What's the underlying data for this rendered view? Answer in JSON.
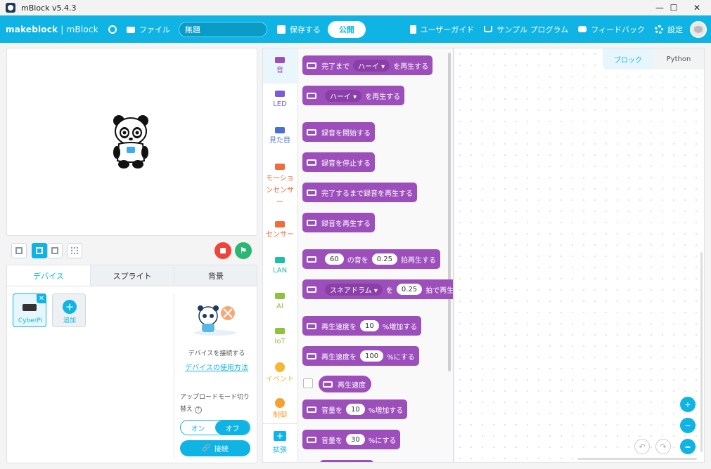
{
  "window": {
    "title": "mBlock v5.4.3",
    "controls": {
      "minimize": "—",
      "maximize": "☐",
      "close": "✕"
    }
  },
  "menubar": {
    "brand": "makeblock",
    "brand_sub": " | mBlock",
    "file": "ファイル",
    "project_name": "無題",
    "save": "保存する",
    "publish": "公開",
    "user_guide": "ユーザーガイド",
    "sample_programs": "サンプル プログラム",
    "feedback": "フィードバック",
    "settings": "設定"
  },
  "device_panel": {
    "tabs": [
      "デバイス",
      "スプライト",
      "背景"
    ],
    "device_name": "CyberPi",
    "add_label": "追加",
    "connect_text": "デバイスを接続する",
    "usage_link": "デバイスの使用方法",
    "upload_mode": "アップロードモード切り替え",
    "upload_help": "?",
    "toggle_on": "オン",
    "toggle_off": "オフ",
    "connect_button": "接続"
  },
  "categories": [
    {
      "label": "音",
      "color": "#9c4fbb"
    },
    {
      "label": "LED",
      "color": "#7a5cd6"
    },
    {
      "label": "見た目",
      "color": "#4c6fcf"
    },
    {
      "label": "モーションセンサー",
      "color": "#f26b3a"
    },
    {
      "label": "センサー",
      "color": "#f26b3a"
    },
    {
      "label": "LAN",
      "color": "#1fbfa7"
    },
    {
      "label": "AI",
      "color": "#8fc13f"
    },
    {
      "label": "IoT",
      "color": "#8fc13f"
    },
    {
      "label": "イベント",
      "color": "#f7b731"
    },
    {
      "label": "制御",
      "color": "#f7a030"
    }
  ],
  "extension_label": "拡張",
  "blocks": {
    "b1": {
      "t1": "完了まで",
      "dd": "ハーイ ▾",
      "t2": "を再生する"
    },
    "b2": {
      "dd": "ハーイ ▾",
      "t2": "を再生する"
    },
    "b3": "録音を開始する",
    "b4": "録音を停止する",
    "b5": "完了するまで録音を再生する",
    "b6": "録音を再生する",
    "b7": {
      "v1": "60",
      "t1": "の音を",
      "v2": "0.25",
      "t2": "拍再生する"
    },
    "b8": {
      "dd": "スネアドラム ▾",
      "t1": "を",
      "v1": "0.25",
      "t2": "拍で再生"
    },
    "b9": {
      "t1": "再生速度を",
      "v1": "10",
      "t2": "%増加する"
    },
    "b10": {
      "t1": "再生速度を",
      "v1": "100",
      "t2": "%にする"
    },
    "b11": "再生速度",
    "b12": {
      "t1": "音量を",
      "v1": "10",
      "t2": "%増加する"
    },
    "b13": {
      "t1": "音量を",
      "v1": "30",
      "t2": "%にする"
    }
  },
  "workspace": {
    "tab_blocks": "ブロック",
    "tab_python": "Python"
  },
  "colors": {
    "accent": "#0fb4e4",
    "block_purple": "#9c4fbb",
    "stop": "#f0433a",
    "go": "#2bb673"
  }
}
